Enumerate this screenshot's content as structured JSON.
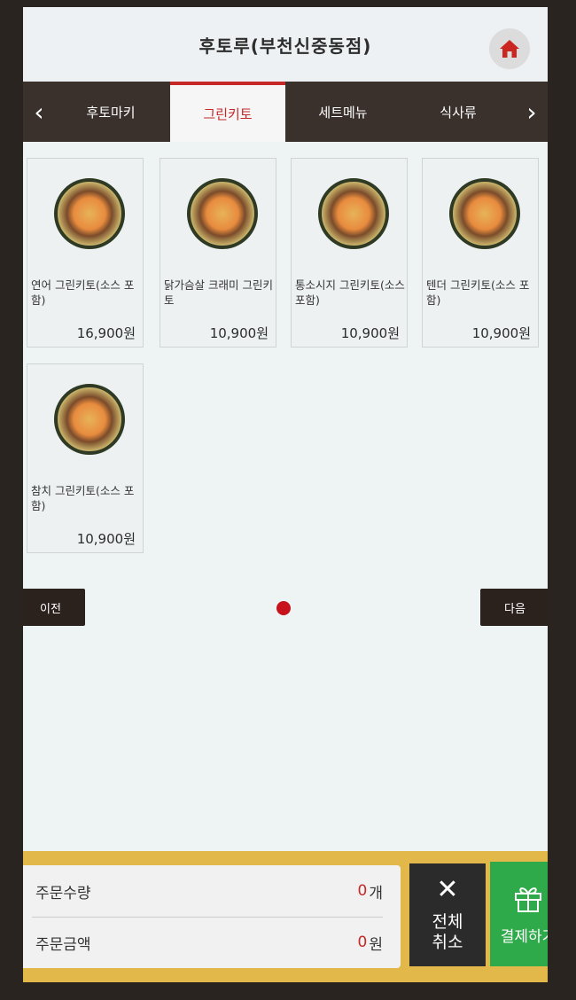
{
  "header": {
    "title": "후토루(부천신중동점)"
  },
  "tabs": [
    "후토마키",
    "그린키토",
    "세트메뉴",
    "식사류"
  ],
  "active_tab": "그린키토",
  "products": [
    {
      "name": "연어 그린키토(소스 포함)",
      "price": "16,900원"
    },
    {
      "name": "닭가슴살 크래미 그린키토",
      "price": "10,900원"
    },
    {
      "name": "통소시지 그린키토(소스 포함)",
      "price": "10,900원"
    },
    {
      "name": "텐더 그린키토(소스 포함)",
      "price": "10,900원"
    },
    {
      "name": "참치 그린키토(소스 포함)",
      "price": "10,900원"
    }
  ],
  "pagination": {
    "prev_label": "이전",
    "next_label": "다음"
  },
  "order": {
    "qty_label": "주문수량",
    "qty_value": "0",
    "qty_unit": "개",
    "amount_label": "주문금액",
    "amount_value": "0",
    "amount_unit": "원"
  },
  "actions": {
    "cancel_label": "전체 취소",
    "pay_label": "결제하기"
  },
  "colors": {
    "accent": "#c62828",
    "tab_bar": "#3a302c",
    "pay": "#2eaa4a",
    "footer": "#e3b84a"
  }
}
